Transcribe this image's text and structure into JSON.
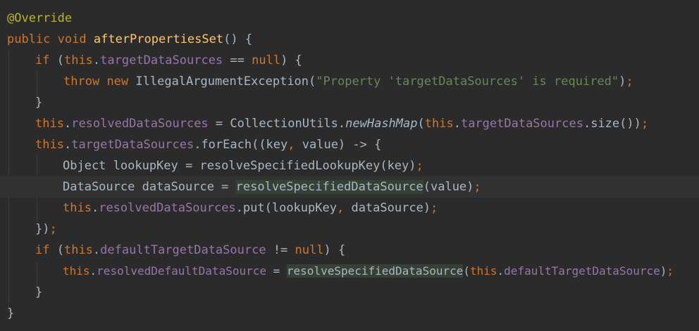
{
  "editor": {
    "lines": [
      {
        "parts": [
          {
            "t": "@Override",
            "c": "ann"
          }
        ]
      },
      {
        "parts": [
          {
            "t": "public",
            "c": "kw"
          },
          {
            "t": " ",
            "c": ""
          },
          {
            "t": "void",
            "c": "kw"
          },
          {
            "t": " ",
            "c": ""
          },
          {
            "t": "afterPropertiesSet",
            "c": "fn"
          },
          {
            "t": "() {",
            "c": ""
          }
        ]
      },
      {
        "parts": [
          {
            "t": "if",
            "c": "kw"
          },
          {
            "t": " (",
            "c": ""
          },
          {
            "t": "this",
            "c": "kw"
          },
          {
            "t": ".",
            "c": ""
          },
          {
            "t": "targetDataSources",
            "c": "fld"
          },
          {
            "t": " == ",
            "c": ""
          },
          {
            "t": "null",
            "c": "kw"
          },
          {
            "t": ") {",
            "c": ""
          }
        ]
      },
      {
        "parts": [
          {
            "t": "throw",
            "c": "kw"
          },
          {
            "t": " ",
            "c": ""
          },
          {
            "t": "new",
            "c": "kw"
          },
          {
            "t": " IllegalArgumentException(",
            "c": ""
          },
          {
            "t": "\"Property 'targetDataSources' is required\"",
            "c": "str"
          },
          {
            "t": ")",
            "c": ""
          },
          {
            "t": ";",
            "c": "semi"
          }
        ]
      },
      {
        "parts": [
          {
            "t": "}",
            "c": ""
          }
        ]
      },
      {
        "parts": [
          {
            "t": "this",
            "c": "kw"
          },
          {
            "t": ".",
            "c": ""
          },
          {
            "t": "resolvedDataSources",
            "c": "fld"
          },
          {
            "t": " = CollectionUtils.",
            "c": ""
          },
          {
            "t": "newHashMap",
            "c": "static-call"
          },
          {
            "t": "(",
            "c": ""
          },
          {
            "t": "this",
            "c": "kw"
          },
          {
            "t": ".",
            "c": ""
          },
          {
            "t": "targetDataSources",
            "c": "fld"
          },
          {
            "t": ".size())",
            "c": ""
          },
          {
            "t": ";",
            "c": "semi"
          }
        ]
      },
      {
        "parts": [
          {
            "t": "this",
            "c": "kw"
          },
          {
            "t": ".",
            "c": ""
          },
          {
            "t": "targetDataSources",
            "c": "fld"
          },
          {
            "t": ".forEach((key",
            "c": ""
          },
          {
            "t": ",",
            "c": "semi"
          },
          {
            "t": " value) -> {",
            "c": ""
          }
        ]
      },
      {
        "parts": [
          {
            "t": "Object lookupKey = resolveSpecifiedLookupKey(key)",
            "c": ""
          },
          {
            "t": ";",
            "c": "semi"
          }
        ]
      },
      {
        "parts": [
          {
            "t": "DataSource dataSource = ",
            "c": ""
          },
          {
            "t": "resolveSpecifiedDataSource",
            "c": "hl"
          },
          {
            "t": "(value)",
            "c": ""
          },
          {
            "t": ";",
            "c": "semi"
          }
        ]
      },
      {
        "parts": [
          {
            "t": "this",
            "c": "kw"
          },
          {
            "t": ".",
            "c": ""
          },
          {
            "t": "resolvedDataSources",
            "c": "fld"
          },
          {
            "t": ".put(lookupKey",
            "c": ""
          },
          {
            "t": ",",
            "c": "semi"
          },
          {
            "t": " dataSource)",
            "c": ""
          },
          {
            "t": ";",
            "c": "semi"
          }
        ]
      },
      {
        "parts": [
          {
            "t": "})",
            "c": ""
          },
          {
            "t": ";",
            "c": "semi"
          }
        ]
      },
      {
        "parts": [
          {
            "t": "if",
            "c": "kw"
          },
          {
            "t": " (",
            "c": ""
          },
          {
            "t": "this",
            "c": "kw"
          },
          {
            "t": ".",
            "c": ""
          },
          {
            "t": "defaultTargetDataSource",
            "c": "fld"
          },
          {
            "t": " != ",
            "c": ""
          },
          {
            "t": "null",
            "c": "kw"
          },
          {
            "t": ") {",
            "c": ""
          }
        ]
      },
      {
        "parts": [
          {
            "t": "this",
            "c": "kw"
          },
          {
            "t": ".",
            "c": ""
          },
          {
            "t": "resolvedDefaultDataSource",
            "c": "fld"
          },
          {
            "t": " = ",
            "c": ""
          },
          {
            "t": "resolveSpecifiedDataSource",
            "c": "hl"
          },
          {
            "t": "(",
            "c": ""
          },
          {
            "t": "this",
            "c": "kw"
          },
          {
            "t": ".",
            "c": ""
          },
          {
            "t": "defaultTargetDataSource",
            "c": "fld"
          },
          {
            "t": ")",
            "c": ""
          },
          {
            "t": ";",
            "c": "semi"
          }
        ]
      },
      {
        "parts": [
          {
            "t": "}",
            "c": ""
          }
        ]
      },
      {
        "parts": [
          {
            "t": "}",
            "c": ""
          }
        ]
      }
    ]
  },
  "colors": {
    "background": "#2b2b2b",
    "current_line": "#323232",
    "keyword": "#cc7832",
    "annotation": "#bbb529",
    "field": "#9876aa",
    "string": "#6a8759",
    "method_decl": "#ffc66d",
    "text": "#a9b7c6",
    "usage_highlight": "#344134"
  }
}
